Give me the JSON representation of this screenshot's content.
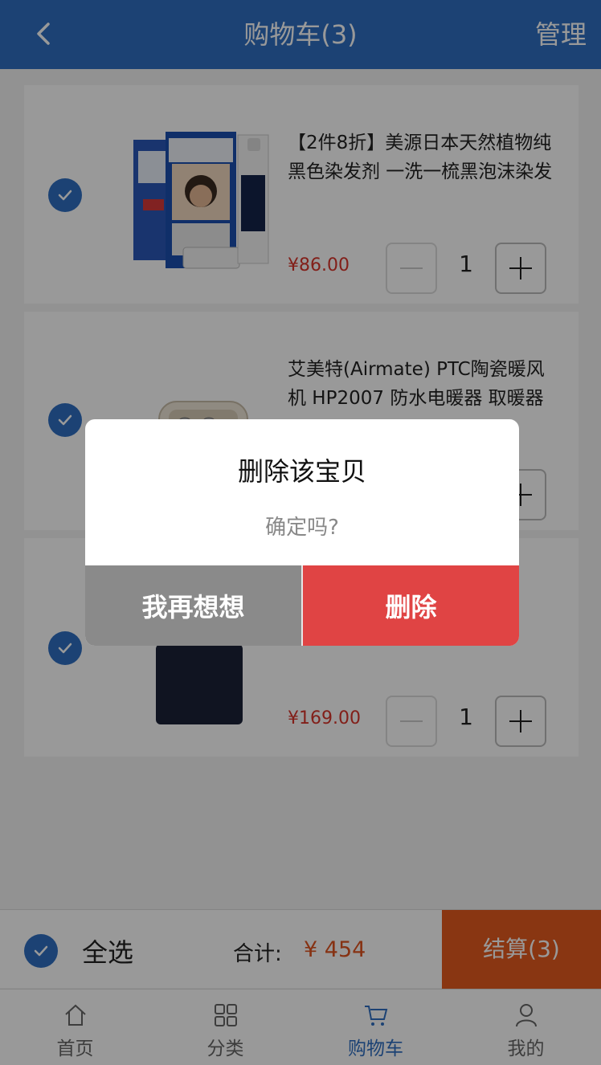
{
  "header": {
    "title": "购物车(3)",
    "manage_label": "管理"
  },
  "cart": {
    "items": [
      {
        "name": "【2件8折】美源日本天然植物纯黑色染发剂 一洗一梳黑泡沫染发膏",
        "price": "¥86.00",
        "quantity": "1",
        "selected": true
      },
      {
        "name": "艾美特(Airmate) PTC陶瓷暖风机 HP2007 防水电暖器 取暖器",
        "price": "",
        "quantity": "",
        "selected": true
      },
      {
        "name": "",
        "price": "¥169.00",
        "quantity": "1",
        "selected": true
      }
    ]
  },
  "bottom_bar": {
    "select_all_label": "全选",
    "total_label": "合计:",
    "total_value": "¥ 454",
    "checkout_label": "结算(3)"
  },
  "tabbar": {
    "tabs": [
      {
        "label": "首页",
        "icon": "home-icon",
        "active": false
      },
      {
        "label": "分类",
        "icon": "grid-icon",
        "active": false
      },
      {
        "label": "购物车",
        "icon": "cart-icon",
        "active": true
      },
      {
        "label": "我的",
        "icon": "user-icon",
        "active": false
      }
    ]
  },
  "dialog": {
    "title": "删除该宝贝",
    "message": "确定吗?",
    "cancel_label": "我再想想",
    "confirm_label": "删除"
  },
  "colors": {
    "primary": "#2f6fc2",
    "price": "#d9342a",
    "checkout": "#e45a1f",
    "delete": "#e04444"
  }
}
